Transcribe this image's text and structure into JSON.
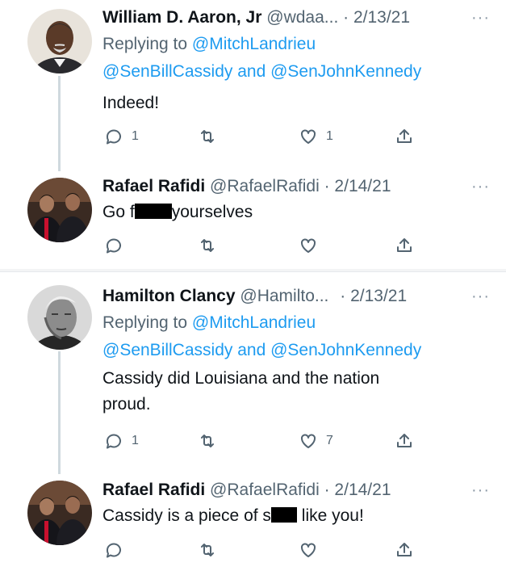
{
  "tweets": [
    {
      "name": "William D. Aaron, Jr",
      "handle": "@wdaa...",
      "date": "· 2/13/21",
      "replying_label": "Replying to",
      "reply_mention": "@MitchLandrieu",
      "mentions_line": "@SenBillCassidy and @SenJohnKennedy",
      "text": "Indeed!",
      "replies": "1",
      "retweets": "",
      "likes": "1"
    },
    {
      "name": "Rafael Rafidi",
      "handle": "@RafaelRafidi",
      "date": "· 2/14/21",
      "text_before": "Go f",
      "text_after": "yourselves",
      "replies": "",
      "retweets": "",
      "likes": ""
    },
    {
      "name": "Hamilton Clancy",
      "handle": "@Hamilto...",
      "date": "· 2/13/21",
      "replying_label": "Replying to",
      "reply_mention": "@MitchLandrieu",
      "mentions_line": "@SenBillCassidy and @SenJohnKennedy",
      "text_line1": "Cassidy did Louisiana and the nation",
      "text_line2": "proud.",
      "replies": "1",
      "retweets": "",
      "likes": "7"
    },
    {
      "name": "Rafael Rafidi",
      "handle": "@RafaelRafidi",
      "date": "· 2/14/21",
      "text_before": "Cassidy is a piece of s",
      "text_after": " like you!",
      "replies": "",
      "retweets": "",
      "likes": ""
    }
  ],
  "more_symbol": "···",
  "colors": {
    "link": "#1d9bf0",
    "muted": "#536471",
    "thread_line": "#cfd9de"
  }
}
